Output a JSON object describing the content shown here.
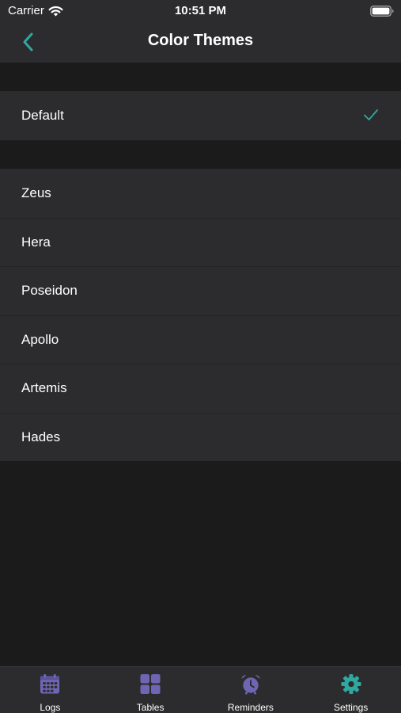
{
  "status_bar": {
    "carrier": "Carrier",
    "time": "10:51 PM",
    "icons": [
      "wifi-icon",
      "battery-icon"
    ]
  },
  "nav": {
    "title": "Color Themes",
    "back_icon": "chevron-left-icon"
  },
  "default_section": {
    "items": [
      {
        "label": "Default",
        "selected": true,
        "icon": "checkmark-icon"
      }
    ]
  },
  "themes_section": {
    "items": [
      {
        "label": "Zeus"
      },
      {
        "label": "Hera"
      },
      {
        "label": "Poseidon"
      },
      {
        "label": "Apollo"
      },
      {
        "label": "Artemis"
      },
      {
        "label": "Hades"
      }
    ]
  },
  "tab_bar": {
    "tabs": [
      {
        "label": "Logs",
        "icon": "calendar-icon",
        "color": "#6e66b3"
      },
      {
        "label": "Tables",
        "icon": "grid-icon",
        "color": "#6e66b3"
      },
      {
        "label": "Reminders",
        "icon": "alarm-clock-icon",
        "color": "#6e66b3"
      },
      {
        "label": "Settings",
        "icon": "gear-icon",
        "color": "#2fa8a0",
        "active": true
      }
    ]
  },
  "colors": {
    "accent_teal": "#2fa8a0",
    "tab_purple": "#6e66b3",
    "background": "#1b1b1c",
    "cell_background": "#2c2c2e"
  }
}
